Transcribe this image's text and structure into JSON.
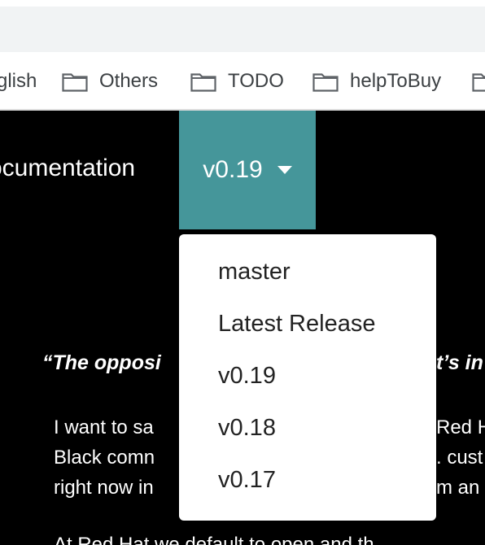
{
  "bookmarks": [
    {
      "label": "glish",
      "icon": "folder-icon"
    },
    {
      "label": "Others",
      "icon": "folder-icon"
    },
    {
      "label": "TODO",
      "icon": "folder-icon"
    },
    {
      "label": "helpToBuy",
      "icon": "folder-icon"
    }
  ],
  "nav": {
    "documentation_label": "ocumentation",
    "version_button_label": "v0.19"
  },
  "dropdown": {
    "items": [
      "master",
      "Latest Release",
      "v0.19",
      "v0.18",
      "v0.17"
    ]
  },
  "background_text": {
    "quote_left": "“The opposi",
    "quote_right": "t’s in",
    "line1_left": "I want to sa",
    "line1_right": "Red H",
    "line2_left": "Black comn",
    "line2_right": ". cust",
    "line3_left": "right now in",
    "line3_right": "m an",
    "line4": "At Red Hat we default to open and th"
  },
  "colors": {
    "accent": "#45969a",
    "background": "#000000"
  }
}
